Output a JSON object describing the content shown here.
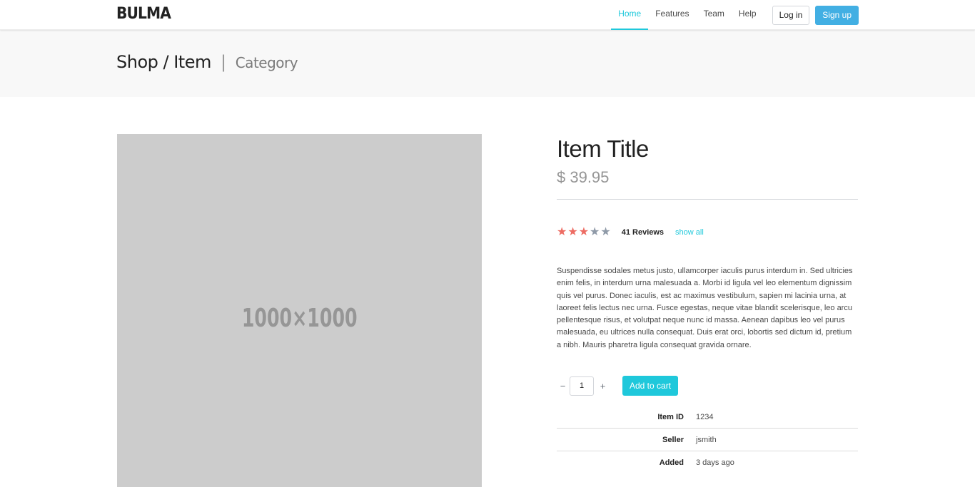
{
  "navbar": {
    "logo": "BULMA",
    "tabs": [
      {
        "label": "Home"
      },
      {
        "label": "Features"
      },
      {
        "label": "Team"
      },
      {
        "label": "Help"
      }
    ],
    "login_label": "Log in",
    "signup_label": "Sign up"
  },
  "hero": {
    "title": "Shop / Item",
    "separator": "|",
    "subtitle": "Category"
  },
  "product": {
    "image_placeholder": "1000×1000",
    "title": "Item Title",
    "price": "$ 39.95",
    "rating": {
      "value": 3,
      "max": 5
    },
    "reviews_label": "41 Reviews",
    "show_all_label": "show all",
    "description": "Suspendisse sodales metus justo, ullamcorper iaculis purus interdum in. Sed ultricies enim felis, in interdum urna malesuada a. Morbi id ligula vel leo elementum dignissim quis vel purus. Donec iaculis, est ac maximus vestibulum, sapien mi lacinia urna, at laoreet felis lectus nec urna. Fusce egestas, neque vitae blandit scelerisque, leo arcu pellentesque risus, et volutpat neque nunc id massa. Aenean dapibus leo vel purus malesuada, eu ultrices nulla consequat. Duis erat orci, lobortis sed dictum id, pretium a nibh. Mauris pharetra ligula consequat gravida ornare.",
    "quantity": "1",
    "minus_label": "−",
    "plus_label": "+",
    "add_to_cart_label": "Add to cart",
    "info": [
      {
        "key": "Item ID",
        "value": "1234"
      },
      {
        "key": "Seller",
        "value": "jsmith"
      },
      {
        "key": "Added",
        "value": "3 days ago"
      }
    ]
  },
  "colors": {
    "accent": "#1fc8db",
    "signup": "#42afe3",
    "star_on": "#ed6c63",
    "star_off": "#8f9aa8",
    "image_bg": "#cccccc"
  }
}
